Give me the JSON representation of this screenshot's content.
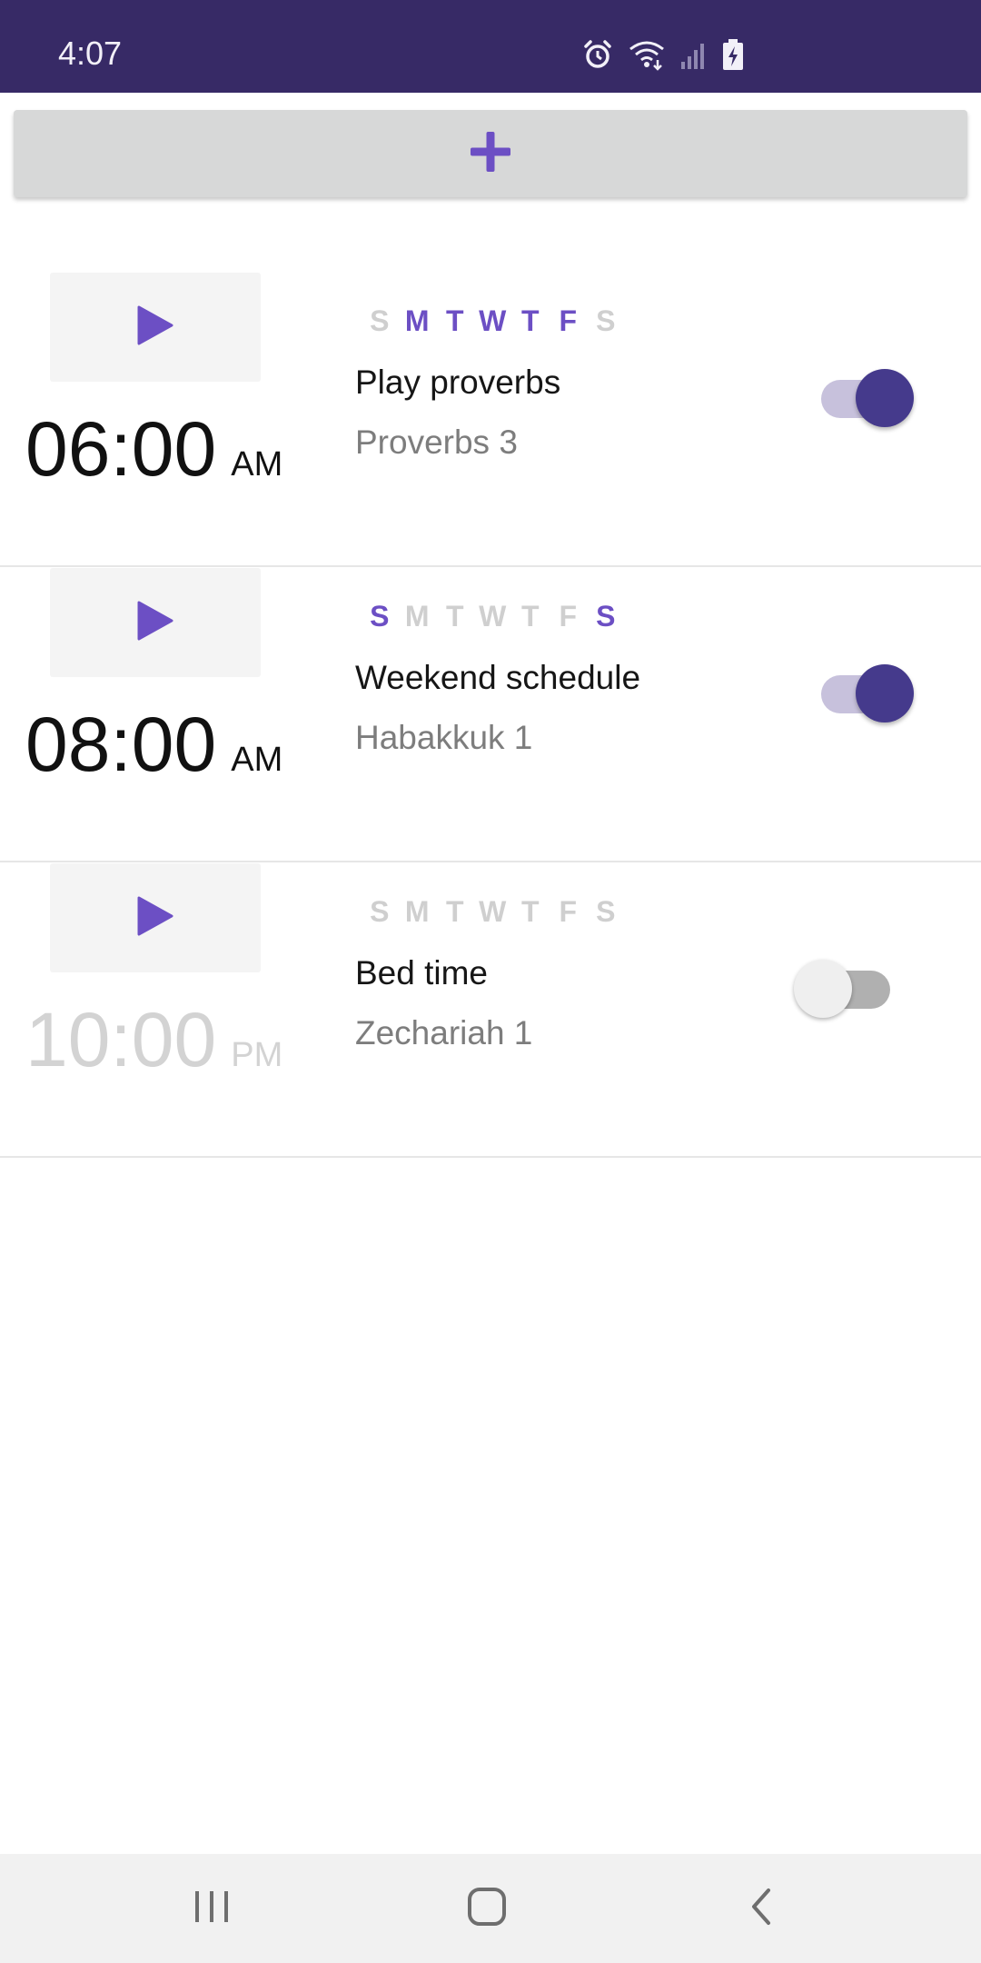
{
  "status_bar": {
    "time": "4:07",
    "icons": [
      "alarm-icon",
      "wifi-icon",
      "signal-icon",
      "battery-charging-icon"
    ]
  },
  "add_button": {
    "icon": "plus-icon",
    "accent": "#6c4fc4"
  },
  "alarms": [
    {
      "time": "06:00",
      "ampm": "AM",
      "label": "Play proverbs",
      "passage": "Proverbs 3",
      "enabled": true,
      "days": [
        {
          "letter": "S",
          "on": false
        },
        {
          "letter": "M",
          "on": true
        },
        {
          "letter": "T",
          "on": true
        },
        {
          "letter": "W",
          "on": true
        },
        {
          "letter": "T",
          "on": true
        },
        {
          "letter": "F",
          "on": true
        },
        {
          "letter": "S",
          "on": false
        }
      ]
    },
    {
      "time": "08:00",
      "ampm": "AM",
      "label": "Weekend schedule",
      "passage": "Habakkuk 1",
      "enabled": true,
      "days": [
        {
          "letter": "S",
          "on": true
        },
        {
          "letter": "M",
          "on": false
        },
        {
          "letter": "T",
          "on": false
        },
        {
          "letter": "W",
          "on": false
        },
        {
          "letter": "T",
          "on": false
        },
        {
          "letter": "F",
          "on": false
        },
        {
          "letter": "S",
          "on": true
        }
      ]
    },
    {
      "time": "10:00",
      "ampm": "PM",
      "label": "Bed time",
      "passage": "Zechariah 1",
      "enabled": false,
      "days": [
        {
          "letter": "S",
          "on": false
        },
        {
          "letter": "M",
          "on": false
        },
        {
          "letter": "T",
          "on": false
        },
        {
          "letter": "W",
          "on": false
        },
        {
          "letter": "T",
          "on": false
        },
        {
          "letter": "F",
          "on": false
        },
        {
          "letter": "S",
          "on": false
        }
      ]
    }
  ],
  "nav_bar": {
    "icons": [
      "recent-apps-icon",
      "home-icon",
      "back-icon"
    ]
  },
  "colors": {
    "status_bar": "#372a66",
    "accent": "#6c4fc4",
    "toggle_on": "#453a8c",
    "inactive_text": "#cfcfcf"
  }
}
